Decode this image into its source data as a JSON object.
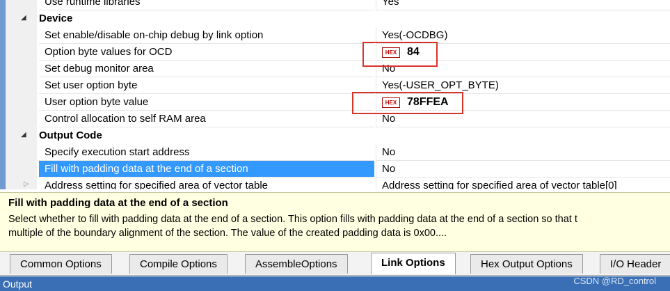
{
  "grid": {
    "rows": [
      {
        "type": "prop",
        "name": "Use runtime libraries",
        "value": "Yes"
      },
      {
        "type": "cat",
        "name": "Device"
      },
      {
        "type": "prop",
        "name": "Set enable/disable on-chip debug by link option",
        "value": "Yes(-OCDBG)"
      },
      {
        "type": "prop",
        "name": "Option byte values for OCD",
        "hex": "HEX",
        "value": "84"
      },
      {
        "type": "prop",
        "name": "Set debug monitor area",
        "value": "No"
      },
      {
        "type": "prop",
        "name": "Set user option byte",
        "value": "Yes(-USER_OPT_BYTE)"
      },
      {
        "type": "prop",
        "name": "User option byte value",
        "hex": "HEX",
        "value": "78FFEA"
      },
      {
        "type": "prop",
        "name": "Control allocation to self RAM area",
        "value": "No"
      },
      {
        "type": "cat",
        "name": "Output Code"
      },
      {
        "type": "prop",
        "name": "Specify execution start address",
        "value": "No"
      },
      {
        "type": "prop",
        "name": "Fill with padding data at the end of a section",
        "value": "No",
        "selected": true
      },
      {
        "type": "prop",
        "name": "Address setting for specified area of vector table",
        "value": "Address setting for specified area of vector table[0]"
      }
    ],
    "expand_glyph": "◢",
    "collapsed_glyph": "▷"
  },
  "description": {
    "title": "Fill with padding data at the end of a section",
    "text": "Select whether to fill with padding data at the end of a section. This option fills with padding data at the end of a section so that t\nmultiple of the boundary alignment of the section. The value of the created padding data is 0x00...."
  },
  "tabs": [
    {
      "label": "Common Options"
    },
    {
      "label": "Compile Options"
    },
    {
      "label": "AssembleOptions"
    },
    {
      "label": "Link Options",
      "active": true
    },
    {
      "label": "Hex Output Options"
    },
    {
      "label": "I/O Header"
    }
  ],
  "output_label": "Output",
  "watermark": "CSDN @RD_control"
}
